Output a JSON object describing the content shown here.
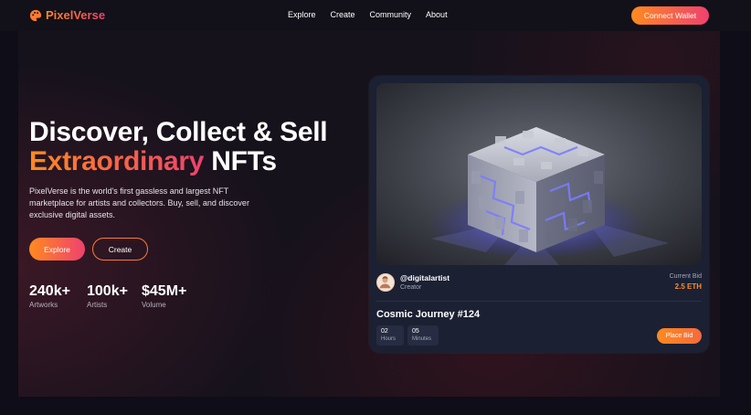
{
  "brand": {
    "name": "PixelVerse",
    "accent_from": "#ff8a1f",
    "accent_to": "#ef416f",
    "logo_icon": "palette-icon"
  },
  "nav": {
    "links": [
      "Explore",
      "Create",
      "Community",
      "About"
    ],
    "wallet_button": "Connect Wallet"
  },
  "hero": {
    "title_line1": "Discover, Collect & Sell",
    "title_highlight": "Extraordinary",
    "title_rest": "NFTs",
    "description": "PixelVerse is the world's first gassless and largest NFT marketplace for artists and collectors. Buy, sell, and discover exclusive digital assets.",
    "explore_button": "Explore",
    "create_button": "Create",
    "stats": [
      {
        "value": "240k+",
        "label": "Artworks"
      },
      {
        "value": "100k+",
        "label": "Artists"
      },
      {
        "value": "$45M+",
        "label": "Volume"
      }
    ]
  },
  "card": {
    "image_subject": "glowing voxel cube",
    "creator_handle": "@digitalartist",
    "creator_label": "Creator",
    "bid_label": "Current Bid",
    "bid_value": "2.5 ETH",
    "title": "Cosmic Journey #124",
    "timers": [
      {
        "value": "02",
        "label": "Hours"
      },
      {
        "value": "05",
        "label": "Minutes"
      }
    ],
    "bid_button": "Place Bid"
  }
}
